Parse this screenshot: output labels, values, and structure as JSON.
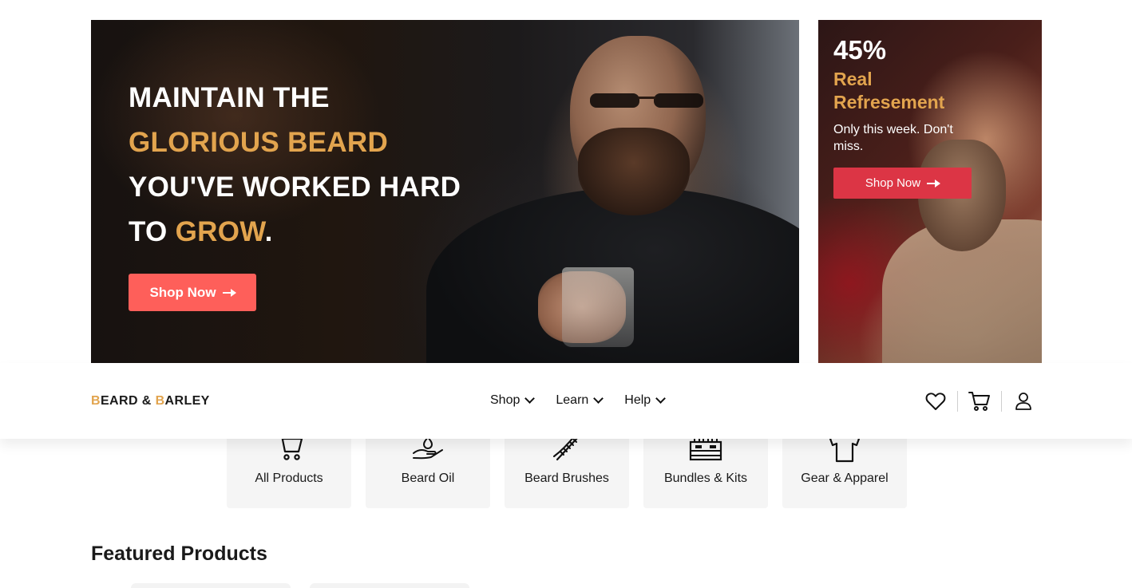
{
  "hero": {
    "line1": "MAINTAIN THE",
    "line2_gold": "GLORIOUS BEARD",
    "line3": "YOU'VE WORKED HARD",
    "line4_prefix": "TO ",
    "line4_gold": "GROW",
    "line4_suffix": ".",
    "button_label": "Shop Now"
  },
  "promo": {
    "percent": "45%",
    "title": "Real Refresement",
    "subtitle": "Only this week. Don't miss.",
    "button_label": "Shop Now"
  },
  "brand": {
    "b1": "B",
    "word1": "EARD",
    "amp": " & ",
    "b2": "B",
    "word2": "ARLEY"
  },
  "nav": {
    "items": [
      {
        "label": "Shop"
      },
      {
        "label": "Learn"
      },
      {
        "label": "Help"
      }
    ],
    "icons": [
      "heart-icon",
      "cart-icon",
      "user-icon"
    ]
  },
  "categories": [
    {
      "label": "All Products",
      "icon": "cart-icon"
    },
    {
      "label": "Beard Oil",
      "icon": "oil-drop-hand-icon"
    },
    {
      "label": "Beard Brushes",
      "icon": "brush-icon"
    },
    {
      "label": "Bundles & Kits",
      "icon": "kit-box-icon"
    },
    {
      "label": "Gear & Apparel",
      "icon": "tshirt-icon"
    }
  ],
  "sections": {
    "featured_title": "Featured Products"
  },
  "colors": {
    "accent_gold": "#e2a44e",
    "hero_button": "#fe5f5a",
    "promo_button": "#dc3545"
  }
}
